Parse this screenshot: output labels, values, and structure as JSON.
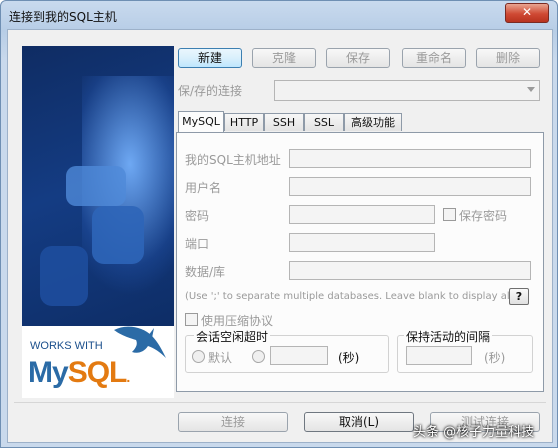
{
  "window": {
    "title": "连接到我的SQL主机",
    "close_glyph": "✕"
  },
  "brand": {
    "works_with": "WORKS WITH",
    "mysql_my": "My",
    "mysql_sql": "SQL",
    "mysql_dot": ".",
    "dolphin_icon": "mysql-dolphin-icon"
  },
  "toolbar": {
    "new_label": "新建",
    "clone_label": "克隆",
    "save_label": "保存",
    "rename_label": "重命名",
    "delete_label": "删除"
  },
  "saved": {
    "label": "保/存的连接",
    "value": ""
  },
  "tabs": [
    {
      "label": "MySQL",
      "active": true
    },
    {
      "label": "HTTP",
      "active": false
    },
    {
      "label": "SSH",
      "active": false
    },
    {
      "label": "SSL",
      "active": false
    },
    {
      "label": "高级功能",
      "active": false
    }
  ],
  "form": {
    "host_label": "我的SQL主机地址",
    "host_value": "",
    "user_label": "用户名",
    "user_value": "",
    "password_label": "密码",
    "password_value": "",
    "save_password_label": "保存密码",
    "save_password_checked": false,
    "port_label": "端口",
    "port_value": "",
    "database_label": "数据/库",
    "database_value": "",
    "database_hint": "(Use ';' to separate multiple databases. Leave blank to display all)",
    "help_label": "?",
    "compress_label": "使用压缩协议",
    "compress_checked": false,
    "idle_group_label": "会话空闲超时",
    "idle_default_label": "默认",
    "idle_custom_value": "",
    "idle_unit": "(秒)",
    "keepalive_group_label": "保持活动的间隔",
    "keepalive_value": "",
    "keepalive_unit": "(秒)"
  },
  "footer": {
    "connect_label": "连接",
    "cancel_label": "取消(L)",
    "test_label": "测试连接"
  },
  "watermark": "头条 @核子力量科技",
  "colors": {
    "title_gradient": "#c9daee",
    "close_red": "#cf4a34",
    "mysql_blue": "#2b6ba6",
    "mysql_orange": "#e37a11",
    "disabled_text": "#9a9a9a"
  }
}
